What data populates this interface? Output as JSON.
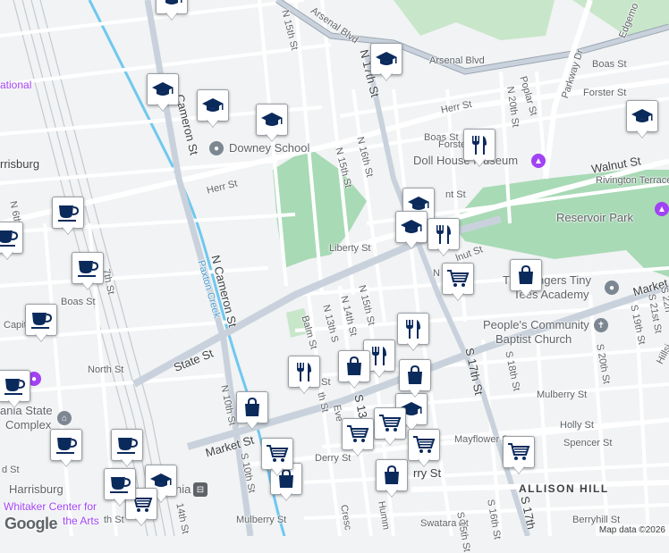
{
  "map": {
    "streets": {
      "arsenal_blvd_1": "Arsenal Blvd",
      "arsenal_blvd_2": "Arsenal Blvd",
      "herr_st_1": "Herr St",
      "herr_st_2": "Herr St",
      "walnut_st_1": "Walnut St",
      "walnut_st_2": "lnut St",
      "state_st": "State St",
      "market_st_1": "Market St",
      "market_st_2": "Market",
      "derry_st_1": "Derry St",
      "derry_st_2": "rry St",
      "mulberry_st_1": "Mulberry St",
      "mulberry_st_2": "Mulberry St",
      "liberty_st": "Liberty St",
      "boas_st_1": "Boas St",
      "boas_st_2": "Boas St",
      "boas_st_3": "Boas St",
      "north_st": "North St",
      "capitol_st": "Capitol St",
      "forster_st_1": "Forster St",
      "forster_st_2": "Forste",
      "holly_st": "Holly St",
      "spencer_st": "Spencer St",
      "mayflower_st": "Mayflower St",
      "rivington_terrace": "Rivington Terrace",
      "parkway_dr": "Parkway Dr",
      "edgemont": "Edgemo",
      "poplar_st": "Poplar St",
      "berryhill_st": "Berryhill St",
      "swatara_st": "Swatara St",
      "balm_st": "Balm St",
      "crescent": "Cresc",
      "humm": "Humm",
      "ev": "Eve",
      "ley_st": "ley St",
      "th_st": "th St",
      "n_15th_st_top": "N 15th St",
      "n_15th_st": "N 15th St",
      "n_15th_st_2": "N 15th St",
      "n_16th_st": "N 16th St",
      "n_17th_st": "N 17th St",
      "n_20th_st": "N 20th St",
      "n_14th_st": "N 14th St",
      "n_13th_st": "N 13th S",
      "n_cameron_st_1": "N Cameron St",
      "n_cameron_st_2": "Cameron St",
      "n_10th_st": "N 10th St",
      "s_10th_st": "S 10th St",
      "n_7th_st": "7th St",
      "n_6th_st": "N 6th St",
      "s_13th": "S 13",
      "s_17th_st": "S 17th St",
      "s_17th_st_2": "S 17th",
      "s_18th_st": "S 18th St",
      "s_20th_st": "S 20th St",
      "s_21st_st": "S 21st St",
      "s_22nd": "S 22n",
      "s_16th_st": "S 16th St",
      "s_14th": "14th St",
      "n_17th_partial": "N",
      "hillside": "Hillsi",
      "s_19th": "S 19th St",
      "s_15th": "S 15th St",
      "nt_st": "nt St",
      "th_st_b": "th St",
      "d_st": "d St"
    },
    "places": {
      "downey_school": "Downey School",
      "doll_house_museum": "Doll House Museum",
      "reservoir_park": "Reservoir Park",
      "tiny_tees_academy_1": "The Gingers Tiny",
      "tiny_tees_academy_2": "Tees Academy",
      "peoples_church_1": "People's Community",
      "peoples_church_2": "Baptist Church",
      "state_complex_1": "ania State",
      "state_complex_2": "Complex",
      "harrisburg": "rrisburg",
      "harrisburg_station": "Harrisburg",
      "whitaker_1": "Whitaker Center for",
      "whitaker_2": "the Arts",
      "allison_hill": "ALLISON HILL",
      "paxton_creek": "Paxton Creek",
      "national": "ational",
      "nia": "nia"
    },
    "attribution": "Map data ©2026",
    "logo": "Google"
  },
  "icon_names": {
    "school": "graduation-cap-icon",
    "restaurant": "fork-knife-icon",
    "shopping": "shopping-bag-icon",
    "grocery": "shopping-cart-icon",
    "cafe": "coffee-cup-icon"
  },
  "colors": {
    "marker_icon": "#0b2a5c",
    "park": "#a8dab5",
    "river": "#6fc8ef",
    "major_road": "#c9d2dc",
    "land": "#f1f3f4",
    "poi_purple": "#a142f4",
    "poi_gray": "#7c8792"
  }
}
